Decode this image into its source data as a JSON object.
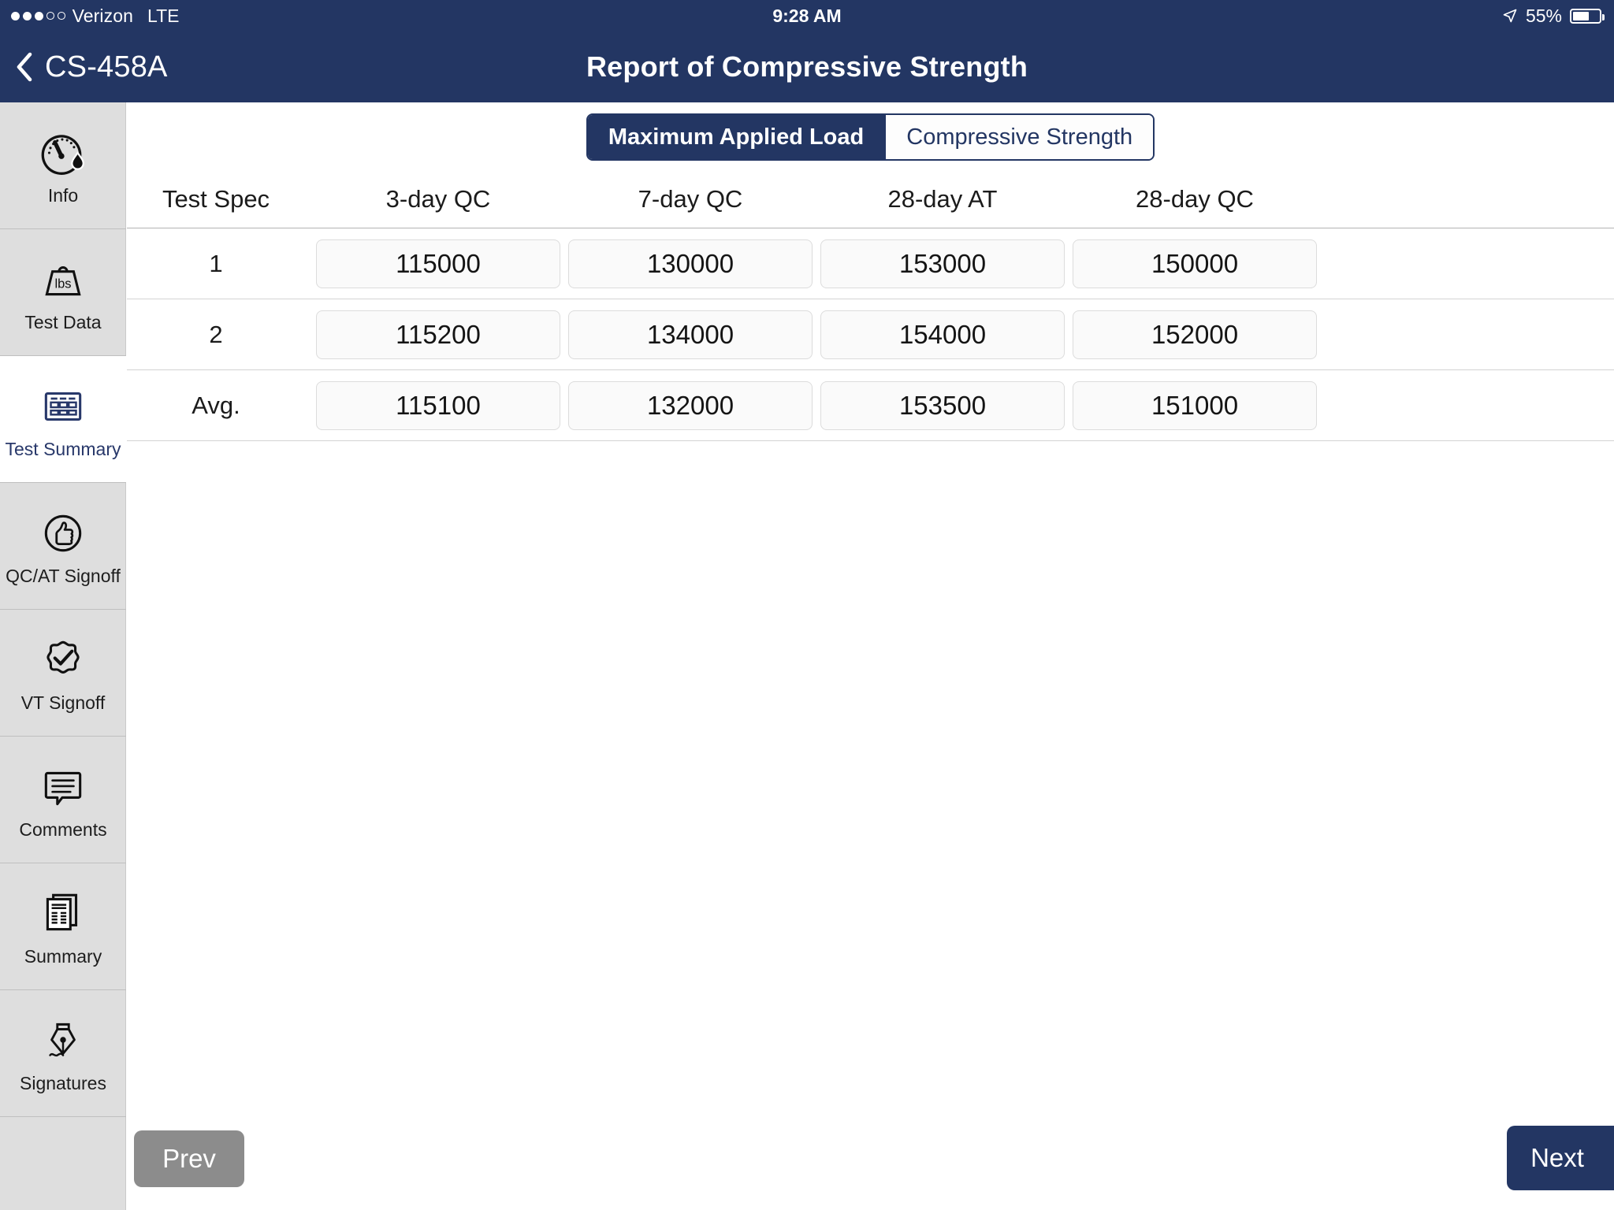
{
  "statusbar": {
    "carrier": "Verizon",
    "network": "LTE",
    "time": "9:28 AM",
    "battery_percent": "55%",
    "signal_filled": 3,
    "signal_total": 5,
    "battery_level": 55,
    "location_icon": "location-arrow-icon"
  },
  "navbar": {
    "back_label": "CS-458A",
    "back_icon": "chevron-left-icon",
    "title": "Report of Compressive Strength",
    "background": "#233663"
  },
  "sidebar": {
    "items": [
      {
        "label": "Info",
        "icon": "gauge-droplet-icon",
        "active": false
      },
      {
        "label": "Test Data",
        "icon": "weight-lbs-icon",
        "active": false
      },
      {
        "label": "Test Summary",
        "icon": "table-grid-icon",
        "active": true
      },
      {
        "label": "QC/AT Signoff",
        "icon": "thumbs-up-circle-icon",
        "active": false
      },
      {
        "label": "VT Signoff",
        "icon": "check-badge-icon",
        "active": false
      },
      {
        "label": "Comments",
        "icon": "speech-bubble-lines-icon",
        "active": false
      },
      {
        "label": "Summary",
        "icon": "documents-stack-icon",
        "active": false
      },
      {
        "label": "Signatures",
        "icon": "fountain-pen-nib-icon",
        "active": false
      }
    ]
  },
  "segmented_control": {
    "options": [
      "Maximum Applied Load",
      "Compressive Strength"
    ],
    "selected": "Maximum Applied Load"
  },
  "table": {
    "columns": [
      "Test Spec",
      "3-day QC",
      "7-day QC",
      "28-day AT",
      "28-day QC"
    ],
    "rows": [
      {
        "spec": "1",
        "values": [
          "115000",
          "130000",
          "153000",
          "150000"
        ]
      },
      {
        "spec": "2",
        "values": [
          "115200",
          "134000",
          "154000",
          "152000"
        ]
      },
      {
        "spec": "Avg.",
        "values": [
          "115100",
          "132000",
          "153500",
          "151000"
        ]
      }
    ]
  },
  "footer": {
    "prev_label": "Prev",
    "next_label": "Next",
    "prev_color": "#8c8c8c",
    "next_color": "#233663"
  }
}
